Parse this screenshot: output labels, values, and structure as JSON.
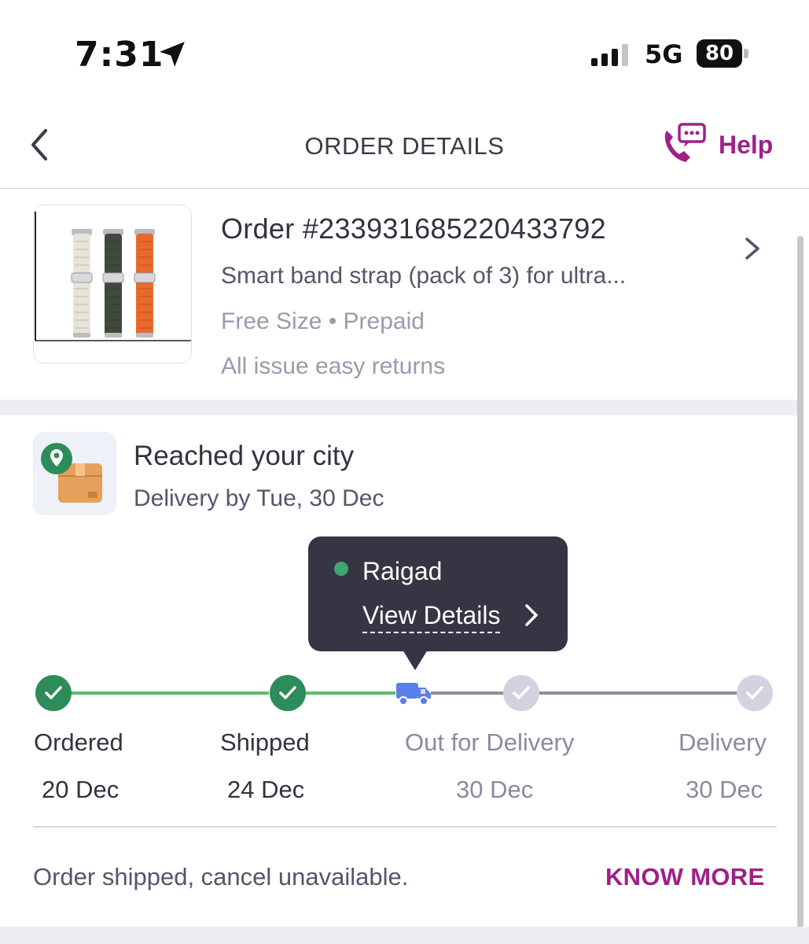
{
  "status_bar": {
    "time": "7:31",
    "network": "5G",
    "battery": "80"
  },
  "header": {
    "title": "ORDER DETAILS",
    "help_label": "Help"
  },
  "product": {
    "order_number": "Order #233931685220433792",
    "name": "Smart band strap (pack of 3) for  ultra...",
    "meta": "Free Size • Prepaid",
    "returns": "All issue easy returns",
    "strap_colors": [
      "#e8e4d8",
      "#3f4a3c",
      "#e8692b"
    ]
  },
  "status": {
    "title": "Reached your city",
    "subtitle": "Delivery by Tue, 30 Dec"
  },
  "tooltip": {
    "location": "Raigad",
    "link_label": "View Details"
  },
  "timeline": {
    "steps": [
      {
        "label": "Ordered",
        "date": "20 Dec",
        "state": "done"
      },
      {
        "label": "Shipped",
        "date": "24 Dec",
        "state": "done"
      },
      {
        "label": "Out for Delivery",
        "date": "30 Dec",
        "state": "pending"
      },
      {
        "label": "Delivery",
        "date": "30 Dec",
        "state": "pending"
      }
    ]
  },
  "footer": {
    "note": "Order shipped, cancel unavailable.",
    "know_more": "KNOW MORE"
  },
  "colors": {
    "brand": "#9f2089",
    "done_green": "#2e8b5a",
    "line_green": "#5bbf6a",
    "pending_grey": "#d4d2e0",
    "truck_blue": "#5b7fea"
  }
}
